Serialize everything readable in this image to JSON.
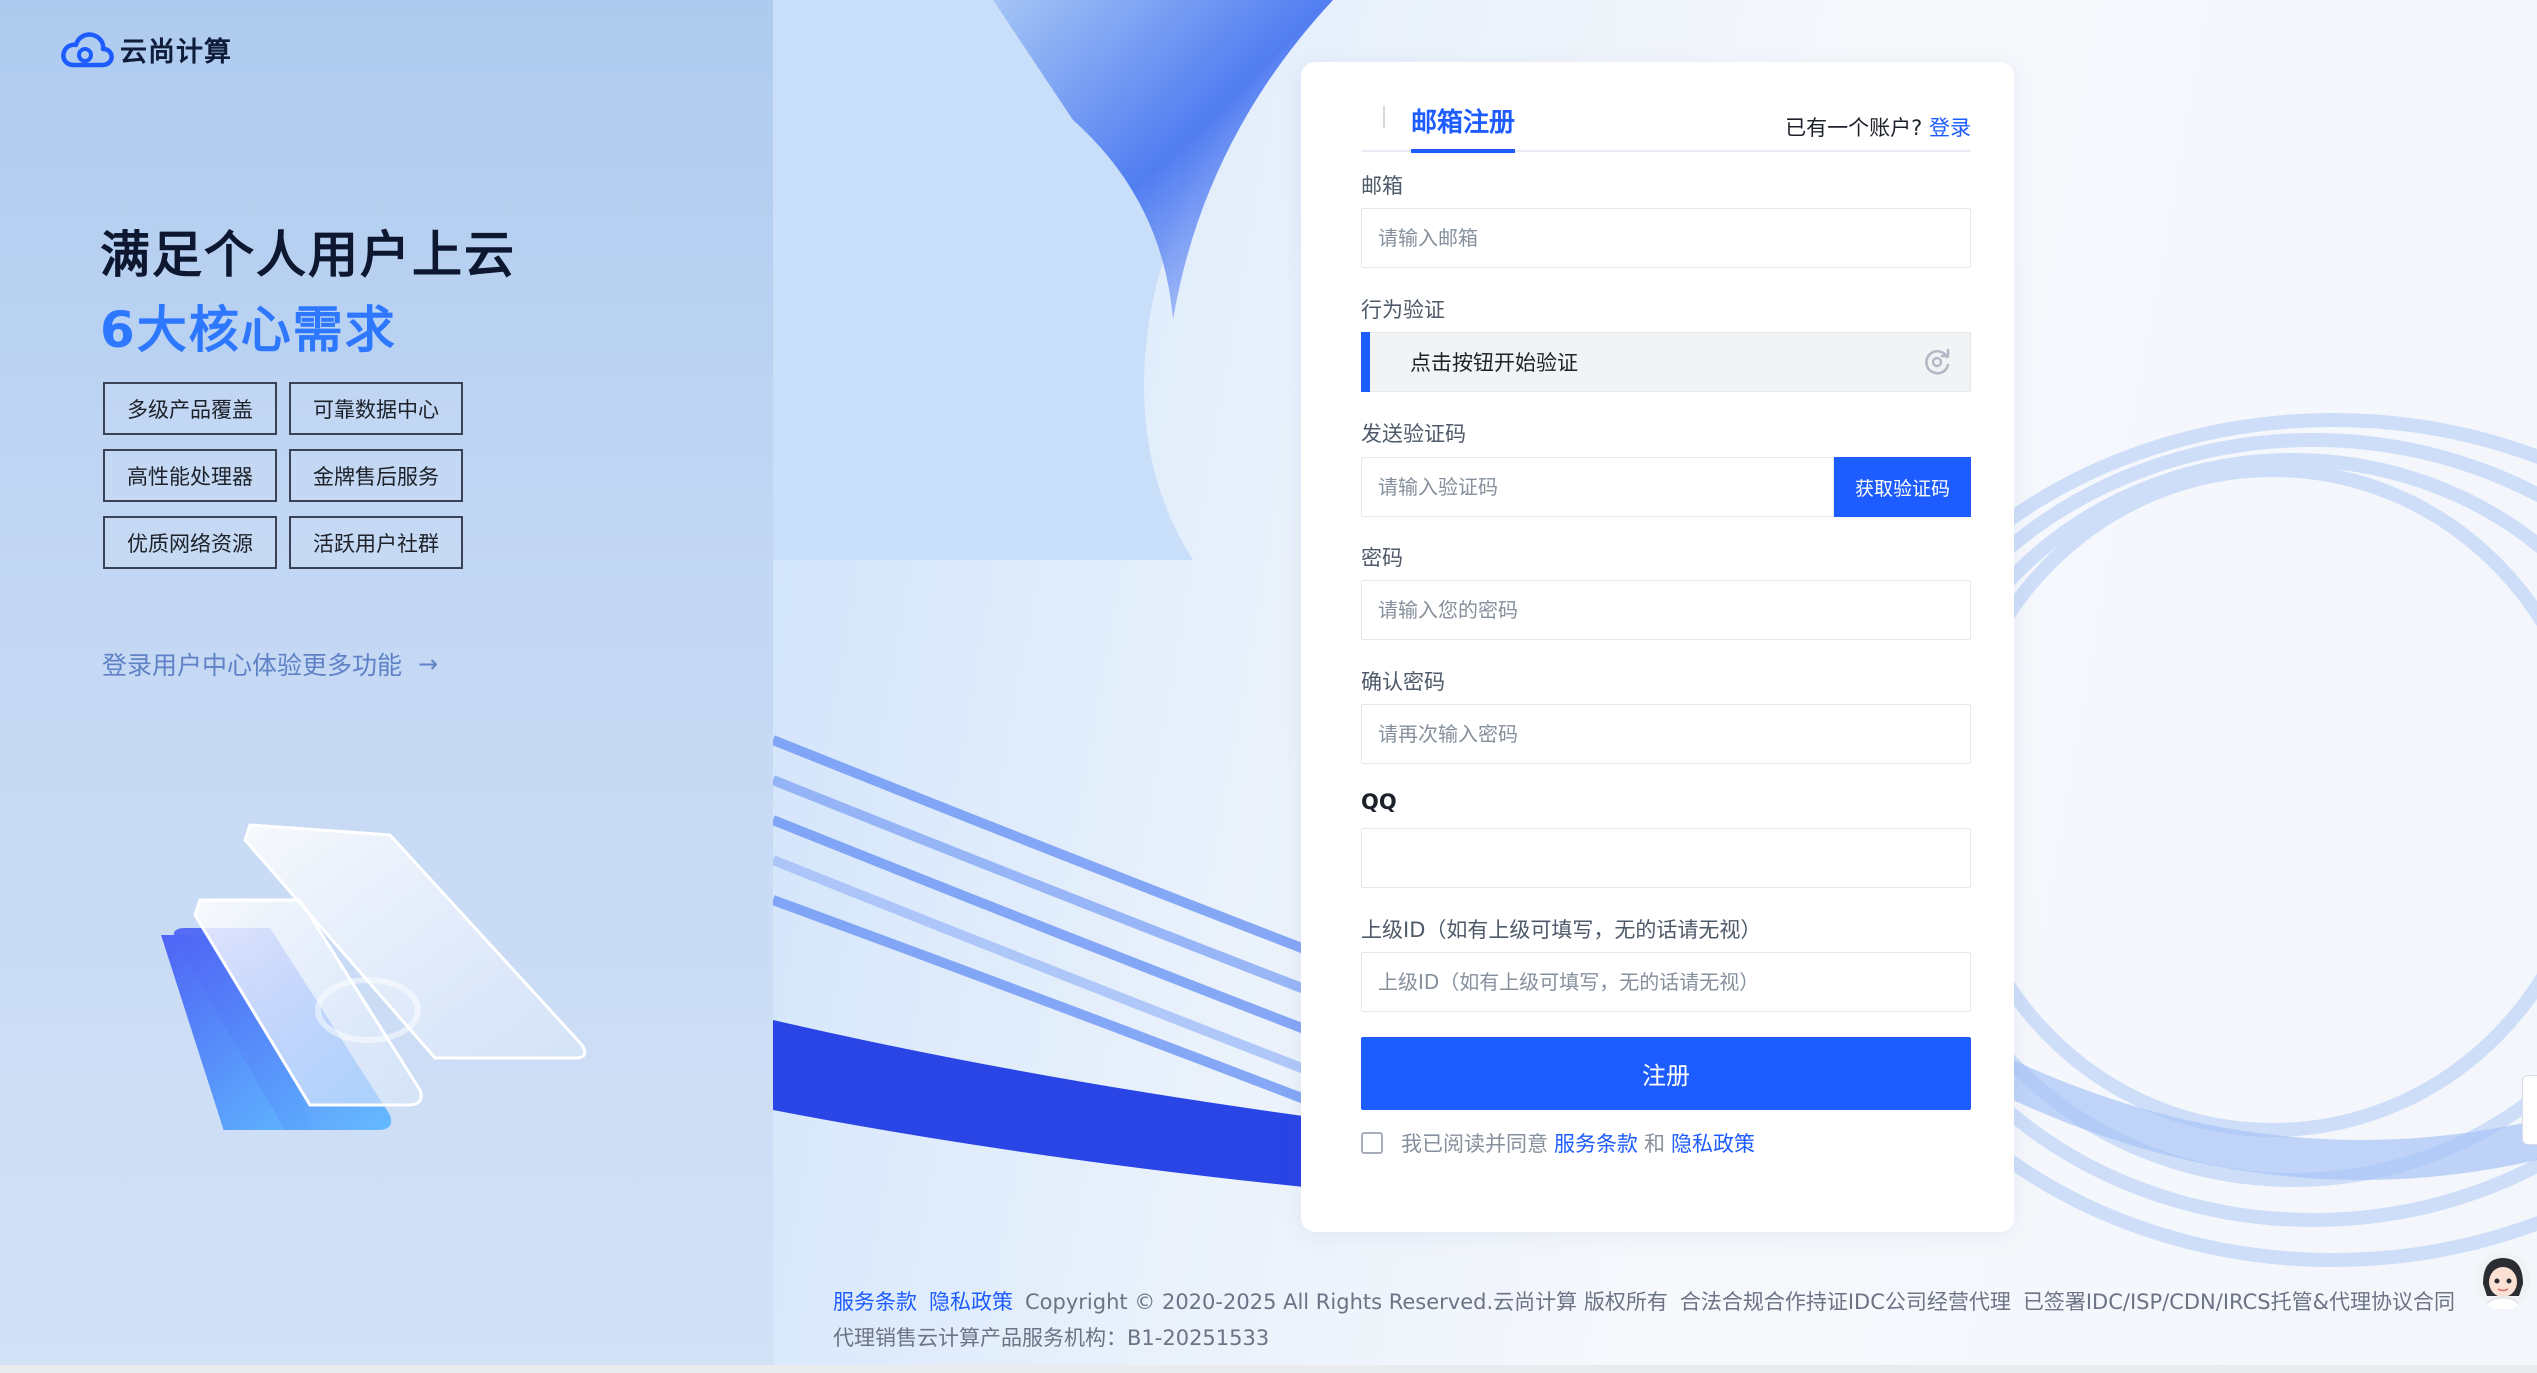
{
  "brand": {
    "name": "云尚计算",
    "accent": "#1d5cff"
  },
  "hero": {
    "line1": "满足个人用户上云",
    "line2": "6大核心需求",
    "features": [
      "多级产品覆盖",
      "可靠数据中心",
      "高性能处理器",
      "金牌售后服务",
      "优质网络资源",
      "活跃用户社群"
    ],
    "login_more": "登录用户中心体验更多功能",
    "login_more_arrow": "→"
  },
  "form": {
    "tab_active": "邮箱注册",
    "have_account": "已有一个账户?",
    "login_link": "登录",
    "email_label": "邮箱",
    "email_placeholder": "请输入邮箱",
    "verify_label": "行为验证",
    "verify_text": "点击按钮开始验证",
    "code_label": "发送验证码",
    "code_placeholder": "请输入验证码",
    "code_button": "获取验证码",
    "password_label": "密码",
    "password_placeholder": "请输入您的密码",
    "confirm_label": "确认密码",
    "confirm_placeholder": "请再次输入密码",
    "qq_label": "QQ",
    "qq_placeholder": "",
    "parent_label": "上级ID（如有上级可填写，无的话请无视）",
    "parent_placeholder": "上级ID（如有上级可填写，无的话请无视）",
    "submit": "注册",
    "agree_text": "我已阅读并同意",
    "terms_link": "服务条款",
    "and": "和",
    "privacy_link": "隐私政策"
  },
  "footer": {
    "terms": "服务条款",
    "privacy": "隐私政策",
    "copyright": "Copyright © 2020-2025 All Rights Reserved.云尚计算 版权所有",
    "idc": "合法合规合作持证IDC公司经营代理",
    "signed": "已签署IDC/ISP/CDN/IRCS托管&代理协议合同",
    "line2": "代理销售云计算产品服务机构：B1-20251533"
  }
}
